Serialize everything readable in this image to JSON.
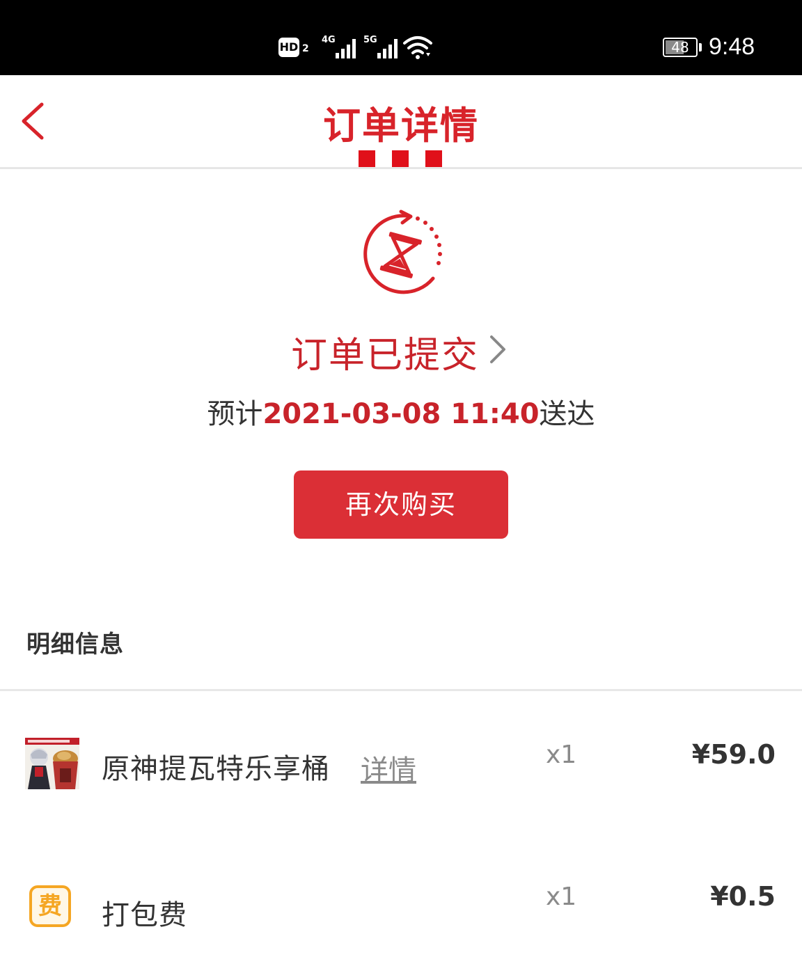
{
  "status_bar": {
    "hd_label": "HD",
    "hd_sub": "2",
    "net1_label": "4G",
    "net2_label": "5G",
    "battery": "48",
    "time": "9:48"
  },
  "header": {
    "title": "订单详情",
    "back_icon": "chevron-left-icon"
  },
  "order_status": {
    "icon": "hourglass-refresh-icon",
    "title": "订单已提交",
    "chevron_icon": "chevron-right-icon",
    "eta_prefix": "预计",
    "eta_time": "2021-03-08 11:40",
    "eta_suffix": "送达",
    "rebuy_label": "再次购买"
  },
  "details": {
    "section_title": "明细信息",
    "items": [
      {
        "name": "原神提瓦特乐享桶",
        "detail_link": "详情",
        "qty": "x1",
        "price": "¥59.0",
        "thumb_icon": "product-bucket-image"
      },
      {
        "name": "打包费",
        "icon_text": "费",
        "qty": "x1",
        "price": "¥0.5"
      }
    ]
  },
  "colors": {
    "brand_red": "#d8232a",
    "button_red": "#db2f36",
    "fee_orange": "#f5a623"
  }
}
